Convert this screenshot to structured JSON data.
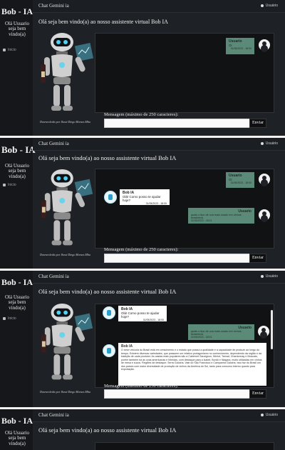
{
  "panel1": {
    "brand": "Bob - IA",
    "welcome_side": "Olá Usuario seja bem vindo(a)",
    "nav_home": "Inicio",
    "app_title": "Chat Gemini ia",
    "user_label": "Usuário",
    "heading": "Olá seja bem vindo(a) ao nosso assistente virtual Bob IA",
    "credit": "Desenvolvido por Jhosé Diego Moraes Mbu",
    "messages": [
      {
        "who": "Usuario",
        "text": "Oi",
        "time": "31/05/2023 - 18:00"
      }
    ],
    "prompt_label": "Mensagem (máximo de 250 caracteres):",
    "send": "Enviar"
  },
  "panel2": {
    "brand": "Bob - IA",
    "welcome_side": "Olá Usuario seja bem vindo(a)",
    "nav_home": "Inicio",
    "app_title": "Chat Gemini ia",
    "user_label": "Usuário",
    "heading": "Olá seja bem vindo(a) ao nosso assistente virtual Bob IA",
    "credit": "Desenvolvido por Jhosé Diego Moraes Mbu",
    "messages": [
      {
        "who": "Usuario",
        "text": "Oi",
        "time": "31/05/2023 - 18:00"
      },
      {
        "who": "Bob IA",
        "text": "Olá! Como posso te ajudar hoje?",
        "time": "31/05/2023 - 18:00"
      },
      {
        "who": "Usuario",
        "text": "quais o tipo de uva mais usado em vinhos brasileiros",
        "time": "31/05/2023 - 18:01"
      }
    ],
    "prompt_label": "Mensagem (máximo de 250 caracteres):",
    "send": "Enviar"
  },
  "panel3": {
    "brand": "Bob - IA",
    "welcome_side": "Olá Usuario seja bem vindo(a)",
    "nav_home": "Inicio",
    "app_title": "Chat Gemini ia",
    "user_label": "Usuário",
    "heading": "Olá seja bem vindo(a) ao nosso assistente virtual Bob IA",
    "credit": "Desenvolvido por Jhosé Diego Moraes Mbu",
    "messages": [
      {
        "who": "Bob IA",
        "text": "Olá! Como posso te ajudar hoje?",
        "time": "31/05/2023 - 18:00"
      },
      {
        "who": "Usuario",
        "text": "quais o tipo de uva mais usado em vinhos brasileiros",
        "time": "31/05/2023 - 18:01"
      },
      {
        "who": "Bob IA",
        "text": "O setor vinícola do Brasil está em crescimento e o estado que possui a qualidade e a capacidade de produzir ao longo do tempo. Existem diversas variedades, que possuem um relativo protagonismo no conhecimento, dependendo da região e da tradição de cada produtor. As castas mais populares são a Cabernet Sauvignon, Merlot, Tannat, Chardonnay e Moscato, porém também há as uvas americanas e híbridas, com destaque para a Isabel, Bordô e Niágara, muito utilizadas em vinhos de mesa e sucos. Regiões de destaque: Serra Gaúcha, Vale do São Francisco e Campanha Gaúcha. Isso faz do Brasil um dos países com maior diversidade de produção de vinhos da América do Sul, tanto para consumo interno quanto para exportação.",
        "time": "31/05/2023 - 18:01"
      }
    ],
    "prompt_label": "Mensagem (máximo de 250 caracteres):",
    "send": "Enviar"
  },
  "panel4": {
    "brand": "Bob - IA",
    "welcome_side": "Olá Usuario seja bem vindo(a)",
    "app_title": "Chat Gemini ia",
    "user_label": "Usuário",
    "heading": "Olá seja bem vindo(a) ao nosso assistente virtual Bob IA"
  },
  "colors": {
    "user_bubble": "#5c8a78",
    "bot_bubble": "#ffffff",
    "background": "#1e2126",
    "sidebar": "#15171b"
  }
}
